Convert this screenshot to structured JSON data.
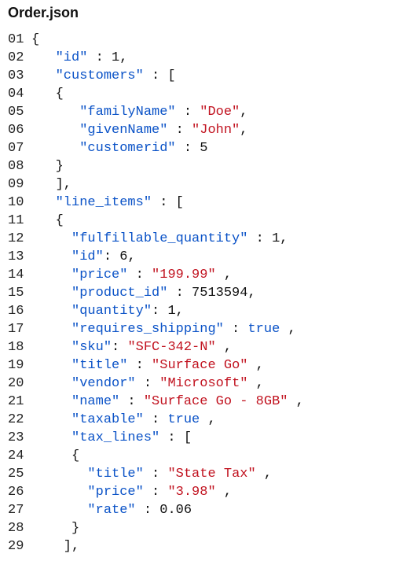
{
  "title": "Order.json",
  "chart_data": {
    "type": "table",
    "note": "JSON document content shown as syntax-highlighted text",
    "json_value": {
      "id": 1,
      "customers": [
        {
          "familyName": "Doe",
          "givenName": "John",
          "customerid": 5
        }
      ],
      "line_items": [
        {
          "fulfillable_quantity": 1,
          "id": 6,
          "price": "199.99",
          "product_id": 7513594,
          "quantity": 1,
          "requires_shipping": true,
          "sku": "SFC-342-N",
          "title": "Surface Go",
          "vendor": "Microsoft",
          "name": "Surface Go - 8GB",
          "taxable": true,
          "tax_lines": [
            {
              "title": "State Tax",
              "price": "3.98",
              "rate": 0.06
            }
          ]
        }
      ]
    }
  },
  "lines": [
    {
      "n": "01",
      "tokens": [
        {
          "t": "{",
          "cls": "p"
        }
      ]
    },
    {
      "n": "02",
      "tokens": [
        {
          "t": "   ",
          "cls": "p"
        },
        {
          "t": "\"id\"",
          "cls": "k"
        },
        {
          "t": " : ",
          "cls": "p"
        },
        {
          "t": "1",
          "cls": "n"
        },
        {
          "t": ",",
          "cls": "p"
        }
      ]
    },
    {
      "n": "03",
      "tokens": [
        {
          "t": "   ",
          "cls": "p"
        },
        {
          "t": "\"customers\"",
          "cls": "k"
        },
        {
          "t": " : [",
          "cls": "p"
        }
      ]
    },
    {
      "n": "04",
      "tokens": [
        {
          "t": "   {",
          "cls": "p"
        }
      ]
    },
    {
      "n": "05",
      "tokens": [
        {
          "t": "      ",
          "cls": "p"
        },
        {
          "t": "\"familyName\"",
          "cls": "k"
        },
        {
          "t": " : ",
          "cls": "p"
        },
        {
          "t": "\"Doe\"",
          "cls": "s"
        },
        {
          "t": ",",
          "cls": "p"
        }
      ]
    },
    {
      "n": "06",
      "tokens": [
        {
          "t": "      ",
          "cls": "p"
        },
        {
          "t": "\"givenName\"",
          "cls": "k"
        },
        {
          "t": " : ",
          "cls": "p"
        },
        {
          "t": "\"John\"",
          "cls": "s"
        },
        {
          "t": ",",
          "cls": "p"
        }
      ]
    },
    {
      "n": "07",
      "tokens": [
        {
          "t": "      ",
          "cls": "p"
        },
        {
          "t": "\"customerid\"",
          "cls": "k"
        },
        {
          "t": " : ",
          "cls": "p"
        },
        {
          "t": "5",
          "cls": "n"
        }
      ]
    },
    {
      "n": "08",
      "tokens": [
        {
          "t": "   }",
          "cls": "p"
        }
      ]
    },
    {
      "n": "09",
      "tokens": [
        {
          "t": "   ],",
          "cls": "p"
        }
      ]
    },
    {
      "n": "10",
      "tokens": [
        {
          "t": "   ",
          "cls": "p"
        },
        {
          "t": "\"line_items\"",
          "cls": "k"
        },
        {
          "t": " : [",
          "cls": "p"
        }
      ]
    },
    {
      "n": "11",
      "tokens": [
        {
          "t": "   {",
          "cls": "p"
        }
      ]
    },
    {
      "n": "12",
      "tokens": [
        {
          "t": "     ",
          "cls": "p"
        },
        {
          "t": "\"fulfillable_quantity\"",
          "cls": "k"
        },
        {
          "t": " : ",
          "cls": "p"
        },
        {
          "t": "1",
          "cls": "n"
        },
        {
          "t": ",",
          "cls": "p"
        }
      ]
    },
    {
      "n": "13",
      "tokens": [
        {
          "t": "     ",
          "cls": "p"
        },
        {
          "t": "\"id\"",
          "cls": "k"
        },
        {
          "t": ": ",
          "cls": "p"
        },
        {
          "t": "6",
          "cls": "n"
        },
        {
          "t": ",",
          "cls": "p"
        }
      ]
    },
    {
      "n": "14",
      "tokens": [
        {
          "t": "     ",
          "cls": "p"
        },
        {
          "t": "\"price\"",
          "cls": "k"
        },
        {
          "t": " : ",
          "cls": "p"
        },
        {
          "t": "\"199.99\"",
          "cls": "s"
        },
        {
          "t": " ,",
          "cls": "p"
        }
      ]
    },
    {
      "n": "15",
      "tokens": [
        {
          "t": "     ",
          "cls": "p"
        },
        {
          "t": "\"product_id\"",
          "cls": "k"
        },
        {
          "t": " : ",
          "cls": "p"
        },
        {
          "t": "7513594",
          "cls": "n"
        },
        {
          "t": ",",
          "cls": "p"
        }
      ]
    },
    {
      "n": "16",
      "tokens": [
        {
          "t": "     ",
          "cls": "p"
        },
        {
          "t": "\"quantity\"",
          "cls": "k"
        },
        {
          "t": ": ",
          "cls": "p"
        },
        {
          "t": "1",
          "cls": "n"
        },
        {
          "t": ",",
          "cls": "p"
        }
      ]
    },
    {
      "n": "17",
      "tokens": [
        {
          "t": "     ",
          "cls": "p"
        },
        {
          "t": "\"requires_shipping\"",
          "cls": "k"
        },
        {
          "t": " : ",
          "cls": "p"
        },
        {
          "t": "true",
          "cls": "b"
        },
        {
          "t": " ,",
          "cls": "p"
        }
      ]
    },
    {
      "n": "18",
      "tokens": [
        {
          "t": "     ",
          "cls": "p"
        },
        {
          "t": "\"sku\"",
          "cls": "k"
        },
        {
          "t": ": ",
          "cls": "p"
        },
        {
          "t": "\"SFC-342-N\"",
          "cls": "s"
        },
        {
          "t": " ,",
          "cls": "p"
        }
      ]
    },
    {
      "n": "19",
      "tokens": [
        {
          "t": "     ",
          "cls": "p"
        },
        {
          "t": "\"title\"",
          "cls": "k"
        },
        {
          "t": " : ",
          "cls": "p"
        },
        {
          "t": "\"Surface Go\"",
          "cls": "s"
        },
        {
          "t": " ,",
          "cls": "p"
        }
      ]
    },
    {
      "n": "20",
      "tokens": [
        {
          "t": "     ",
          "cls": "p"
        },
        {
          "t": "\"vendor\"",
          "cls": "k"
        },
        {
          "t": " : ",
          "cls": "p"
        },
        {
          "t": "\"Microsoft\"",
          "cls": "s"
        },
        {
          "t": " ,",
          "cls": "p"
        }
      ]
    },
    {
      "n": "21",
      "tokens": [
        {
          "t": "     ",
          "cls": "p"
        },
        {
          "t": "\"name\"",
          "cls": "k"
        },
        {
          "t": " : ",
          "cls": "p"
        },
        {
          "t": "\"Surface Go - 8GB\"",
          "cls": "s"
        },
        {
          "t": " ,",
          "cls": "p"
        }
      ]
    },
    {
      "n": "22",
      "tokens": [
        {
          "t": "     ",
          "cls": "p"
        },
        {
          "t": "\"taxable\"",
          "cls": "k"
        },
        {
          "t": " : ",
          "cls": "p"
        },
        {
          "t": "true",
          "cls": "b"
        },
        {
          "t": " ,",
          "cls": "p"
        }
      ]
    },
    {
      "n": "23",
      "tokens": [
        {
          "t": "     ",
          "cls": "p"
        },
        {
          "t": "\"tax_lines\"",
          "cls": "k"
        },
        {
          "t": " : [",
          "cls": "p"
        }
      ]
    },
    {
      "n": "24",
      "tokens": [
        {
          "t": "     {",
          "cls": "p"
        }
      ]
    },
    {
      "n": "25",
      "tokens": [
        {
          "t": "       ",
          "cls": "p"
        },
        {
          "t": "\"title\"",
          "cls": "k"
        },
        {
          "t": " : ",
          "cls": "p"
        },
        {
          "t": "\"State Tax\"",
          "cls": "s"
        },
        {
          "t": " ,",
          "cls": "p"
        }
      ]
    },
    {
      "n": "26",
      "tokens": [
        {
          "t": "       ",
          "cls": "p"
        },
        {
          "t": "\"price\"",
          "cls": "k"
        },
        {
          "t": " : ",
          "cls": "p"
        },
        {
          "t": "\"3.98\"",
          "cls": "s"
        },
        {
          "t": " ,",
          "cls": "p"
        }
      ]
    },
    {
      "n": "27",
      "tokens": [
        {
          "t": "       ",
          "cls": "p"
        },
        {
          "t": "\"rate\"",
          "cls": "k"
        },
        {
          "t": " : ",
          "cls": "p"
        },
        {
          "t": "0.06",
          "cls": "n"
        }
      ]
    },
    {
      "n": "28",
      "tokens": [
        {
          "t": "     }",
          "cls": "p"
        }
      ]
    },
    {
      "n": "29",
      "tokens": [
        {
          "t": "    ],",
          "cls": "p"
        }
      ]
    }
  ]
}
